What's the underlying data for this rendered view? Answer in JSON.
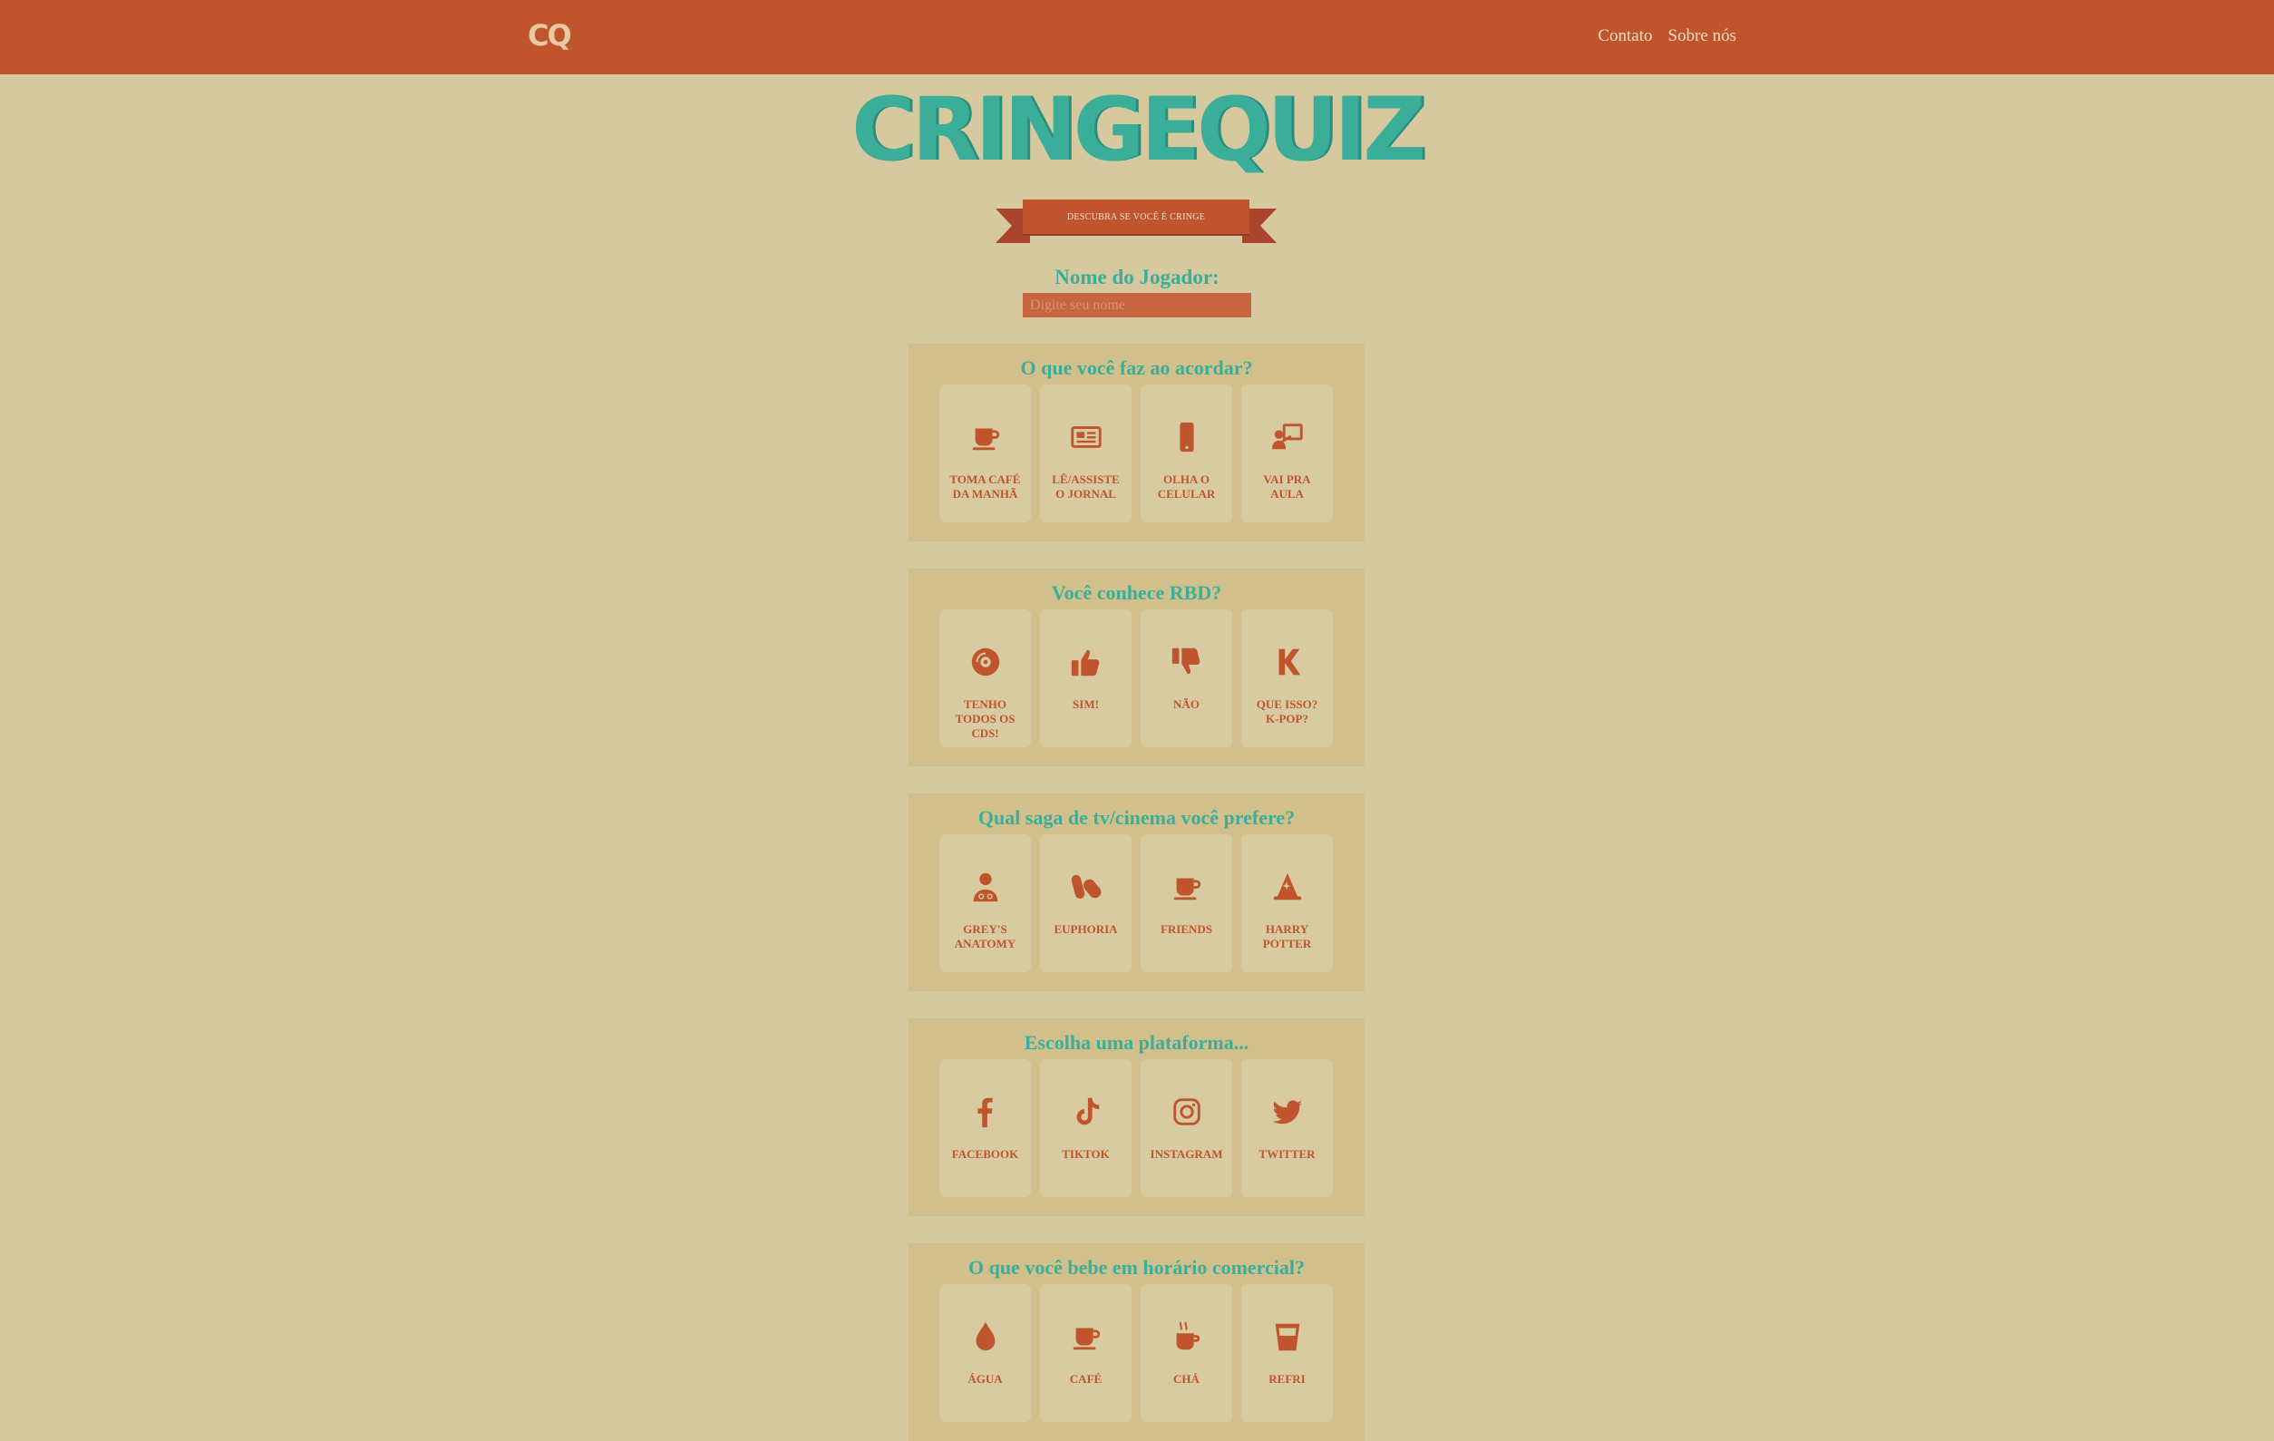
{
  "header": {
    "logo_text": "CQ",
    "nav": [
      "Contato",
      "Sobre nós"
    ]
  },
  "brand": {
    "title": "CRINGEQUIZ",
    "ribbon": "DESCUBRA SE VOCÊ É CRINGE"
  },
  "player": {
    "label": "Nome do Jogador:",
    "placeholder": "Digite seu nome",
    "value": ""
  },
  "colors": {
    "background": "#d6c9a0",
    "header": "#c0552d",
    "accent": "#3aae99",
    "card": "#d1c08c"
  },
  "questions": [
    {
      "title": "O que você faz ao acordar?",
      "options": [
        {
          "label": "TOMA CAFÉ DA MANHÃ",
          "icon": "coffee-icon"
        },
        {
          "label": "LÊ/ASSISTE O JORNAL",
          "icon": "newspaper-icon"
        },
        {
          "label": "OLHA O CELULAR",
          "icon": "phone-icon"
        },
        {
          "label": "VAI PRA AULA",
          "icon": "teacher-icon"
        }
      ]
    },
    {
      "title": "Você conhece RBD?",
      "options": [
        {
          "label": "TENHO TODOS OS CDS!",
          "icon": "compact-disc-icon"
        },
        {
          "label": "SIM!",
          "icon": "thumbs-up-icon"
        },
        {
          "label": "NÃO",
          "icon": "thumbs-down-icon"
        },
        {
          "label": "QUE ISSO? K-POP?",
          "icon": "k-letter-icon"
        }
      ]
    },
    {
      "title": "Qual saga de tv/cinema você prefere?",
      "options": [
        {
          "label": "GREY'S ANATOMY",
          "icon": "doctor-icon"
        },
        {
          "label": "EUPHORIA",
          "icon": "pills-icon"
        },
        {
          "label": "FRIENDS",
          "icon": "coffee-icon"
        },
        {
          "label": "HARRY POTTER",
          "icon": "wizard-hat-icon"
        }
      ]
    },
    {
      "title": "Escolha uma plataforma...",
      "options": [
        {
          "label": "FACEBOOK",
          "icon": "facebook-icon"
        },
        {
          "label": "TIKTOK",
          "icon": "tiktok-icon"
        },
        {
          "label": "INSTAGRAM",
          "icon": "instagram-icon"
        },
        {
          "label": "TWITTER",
          "icon": "twitter-icon"
        }
      ]
    },
    {
      "title": "O que você bebe em horário comercial?",
      "options": [
        {
          "label": "ÁGUA",
          "icon": "water-drop-icon"
        },
        {
          "label": "CAFÉ",
          "icon": "coffee-icon"
        },
        {
          "label": "CHÁ",
          "icon": "hot-mug-icon"
        },
        {
          "label": "REFRI",
          "icon": "glass-icon"
        }
      ]
    }
  ]
}
